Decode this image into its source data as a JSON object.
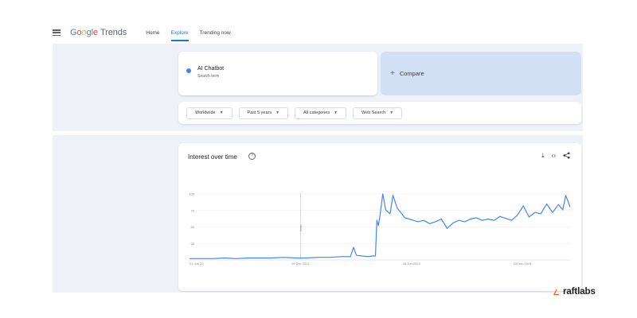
{
  "header": {
    "logo": {
      "google": "Google",
      "product": "Trends"
    },
    "nav": [
      {
        "label": "Home",
        "active": false
      },
      {
        "label": "Explore",
        "active": true
      },
      {
        "label": "Trending now",
        "active": false
      }
    ]
  },
  "search": {
    "term": "AI Chatbot",
    "term_type": "Search term",
    "term_color": "#4285f4",
    "compare_label": "Compare"
  },
  "filters": [
    {
      "label": "Worldwide"
    },
    {
      "label": "Past 5 years"
    },
    {
      "label": "All categories"
    },
    {
      "label": "Web Search"
    }
  ],
  "interest_panel": {
    "title": "Interest over time",
    "actions": [
      "download-icon",
      "embed-icon",
      "share-icon"
    ]
  },
  "chart_data": {
    "type": "line",
    "title": "Interest over time",
    "ylim": [
      0,
      100
    ],
    "y_ticks": [
      "25",
      "50",
      "75",
      "100"
    ],
    "x_tick_labels": [
      "21 Jun 20",
      "19 Dec 2021",
      "18 Jun 2023",
      "15 Dec 2024"
    ],
    "x_range": [
      "2020-06-21",
      "2025-06-15"
    ],
    "note_label": "Note",
    "note_date": "2021-12-19",
    "grid": true,
    "line_color": "#4285f4",
    "series": [
      {
        "x": [
          "2020-06-21",
          "2020-08-16",
          "2020-10-11",
          "2020-12-06",
          "2021-01-31",
          "2021-03-28",
          "2021-05-23",
          "2021-07-18",
          "2021-09-12",
          "2021-11-07",
          "2022-01-02",
          "2022-02-27",
          "2022-04-24",
          "2022-06-19",
          "2022-07-31",
          "2022-08-14",
          "2022-08-28",
          "2022-09-25",
          "2022-10-23",
          "2022-11-13",
          "2022-11-27",
          "2022-12-04",
          "2022-12-11",
          "2022-12-18",
          "2023-01-01",
          "2023-01-15",
          "2023-02-05",
          "2023-02-19",
          "2023-03-12",
          "2023-04-02",
          "2023-04-16",
          "2023-05-07",
          "2023-05-28",
          "2023-06-18",
          "2023-07-16",
          "2023-08-13",
          "2023-09-10",
          "2023-10-08",
          "2023-11-05",
          "2023-12-03",
          "2023-12-31",
          "2024-01-28",
          "2024-02-25",
          "2024-03-24",
          "2024-04-21",
          "2024-05-19",
          "2024-06-16",
          "2024-07-14",
          "2024-08-11",
          "2024-09-08",
          "2024-10-06",
          "2024-11-03",
          "2024-12-01",
          "2024-12-29",
          "2025-01-26",
          "2025-02-23",
          "2025-03-23",
          "2025-04-20",
          "2025-05-11",
          "2025-05-25",
          "2025-06-15"
        ],
        "values": [
          2,
          2,
          2,
          3,
          2,
          3,
          3,
          3,
          4,
          3,
          3,
          4,
          4,
          5,
          5,
          19,
          7,
          6,
          5,
          6,
          6,
          60,
          52,
          65,
          100,
          76,
          70,
          98,
          78,
          70,
          64,
          62,
          60,
          58,
          60,
          55,
          58,
          62,
          48,
          56,
          60,
          58,
          62,
          64,
          60,
          62,
          60,
          66,
          63,
          60,
          68,
          82,
          65,
          72,
          70,
          85,
          72,
          84,
          76,
          98,
          80
        ]
      }
    ]
  },
  "brand": {
    "name": "raftlabs",
    "color": "#ff5a1f"
  }
}
